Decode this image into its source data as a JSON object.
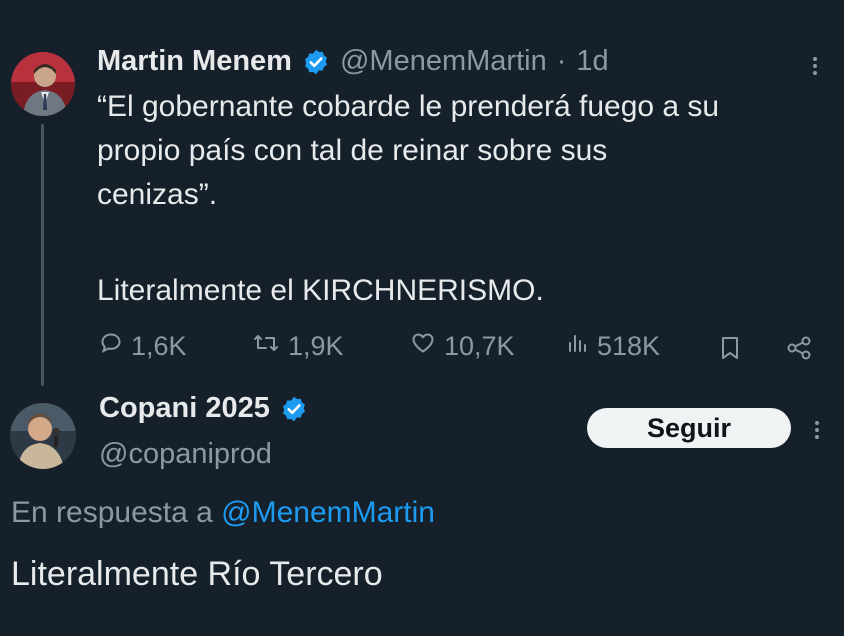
{
  "tweet": {
    "author_name": "Martin Menem",
    "author_handle": "@MenemMartin",
    "separator": "·",
    "time": "1d",
    "text_lines": [
      "“El gobernante cobarde le prenderá fuego a su",
      "propio país con tal de reinar sobre sus",
      "cenizas”.",
      "",
      "Literalmente el KIRCHNERISMO."
    ],
    "stats": {
      "replies": "1,6K",
      "retweets": "1,9K",
      "likes": "10,7K",
      "views": "518K"
    }
  },
  "reply": {
    "author_name": "Copani 2025",
    "author_handle": "@copaniprod",
    "follow_label": "Seguir",
    "in_reply_prefix": "En respuesta a",
    "in_reply_handle": "@MenemMartin",
    "text": "Literalmente Río Tercero"
  },
  "colors": {
    "background": "#15202b",
    "accent": "#1d9bf0",
    "muted": "#8b98a5",
    "verified": "#1d9bf0"
  }
}
